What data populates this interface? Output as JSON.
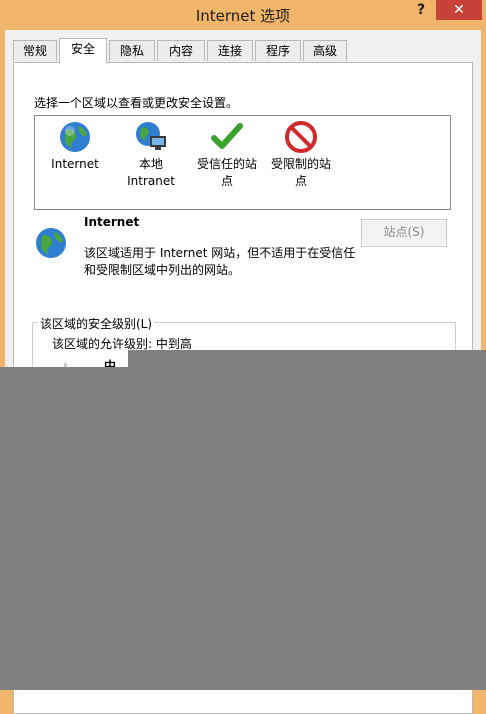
{
  "window": {
    "title": "Internet 选项",
    "help": "?",
    "close": "✕"
  },
  "tabs": [
    "常规",
    "安全",
    "隐私",
    "内容",
    "连接",
    "程序",
    "高级"
  ],
  "active_tab": "安全",
  "security": {
    "prompt": "选择一个区域以查看或更改安全设置。",
    "zones": [
      {
        "label": "Internet",
        "icon": "globe-icon"
      },
      {
        "label": "本地\nIntranet",
        "icon": "intranet-icon"
      },
      {
        "label": "受信任的站\n点",
        "icon": "checkmark-icon"
      },
      {
        "label": "受限制的站\n点",
        "icon": "restricted-icon"
      }
    ],
    "selected_zone": {
      "name": "Internet",
      "description": "该区域适用于 Internet 网站，但不适用于在受信任和受限制区域中列出的网站。"
    },
    "sites_button": "站点(S)",
    "level_group_label": "该区域的安全级别(L)",
    "allowed_levels": "该区域的允许级别: 中到高",
    "current_level": "中"
  },
  "colors": {
    "titlebar": "#f0b46a",
    "close": "#c7413b",
    "overlay": "#808080"
  }
}
